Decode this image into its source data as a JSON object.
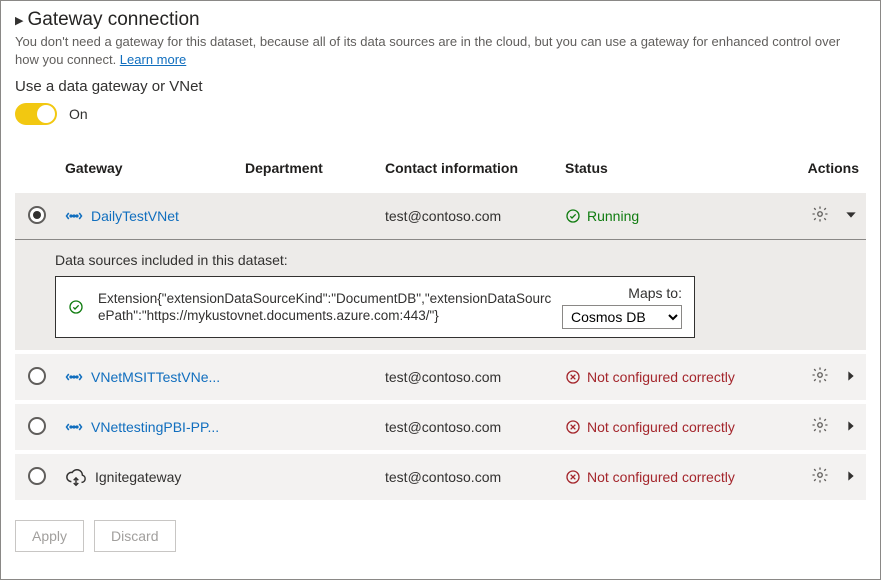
{
  "header": {
    "title": "Gateway connection",
    "description_prefix": "You don't need a gateway for this dataset, because all of its data sources are in the cloud, but you can use a gateway for enhanced control over how you connect. ",
    "learn_more": "Learn more",
    "sub_label": "Use a data gateway or VNet",
    "toggle_state": "On"
  },
  "columns": {
    "gateway": "Gateway",
    "department": "Department",
    "contact": "Contact information",
    "status": "Status",
    "actions": "Actions"
  },
  "gateways": [
    {
      "selected": true,
      "type": "vnet",
      "name": "DailyTestVNet",
      "department": "",
      "contact": "test@contoso.com",
      "status_text": "Running",
      "status_kind": "ok",
      "expanded": true
    },
    {
      "selected": false,
      "type": "vnet",
      "name": "VNetMSITTestVNe...",
      "department": "",
      "contact": "test@contoso.com",
      "status_text": "Not configured correctly",
      "status_kind": "bad",
      "expanded": false
    },
    {
      "selected": false,
      "type": "vnet",
      "name": "VNettestingPBI-PP...",
      "department": "",
      "contact": "test@contoso.com",
      "status_text": "Not configured correctly",
      "status_kind": "bad",
      "expanded": false
    },
    {
      "selected": false,
      "type": "onprem",
      "name": "Ignitegateway",
      "department": "",
      "contact": "test@contoso.com",
      "status_text": "Not configured correctly",
      "status_kind": "bad",
      "expanded": false
    }
  ],
  "datasource_panel": {
    "title": "Data sources included in this dataset:",
    "text": "Extension{\"extensionDataSourceKind\":\"DocumentDB\",\"extensionDataSourcePath\":\"https://mykustovnet.documents.azure.com:443/\"}",
    "maps_to_label": "Maps to:",
    "maps_to_value": "Cosmos DB"
  },
  "footer": {
    "apply": "Apply",
    "discard": "Discard"
  }
}
